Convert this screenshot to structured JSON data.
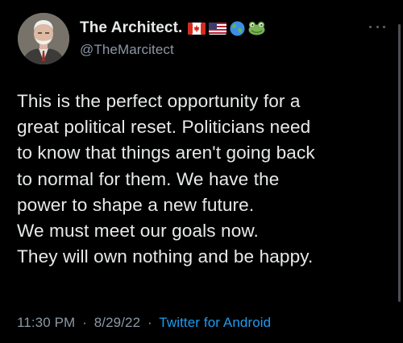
{
  "author": {
    "display_name": "The Architect.",
    "handle": "@TheMarcitect",
    "badges": [
      "canada-flag-icon",
      "us-flag-icon",
      "globe-icon",
      "frog-icon"
    ]
  },
  "tweet": {
    "lines": [
      "This is the perfect opportunity for a",
      "great political reset. Politicians need",
      "to know that things aren't going back",
      "to normal for them. We have the",
      "power to shape a new future.",
      "We must meet our goals now.",
      "They will own nothing and be happy."
    ]
  },
  "meta": {
    "time": "11:30 PM",
    "separator": "·",
    "date": "8/29/22",
    "source": "Twitter for Android"
  },
  "colors": {
    "background": "#000000",
    "text": "#e7e9ea",
    "secondary": "#8b98a5",
    "link": "#1d9bf0"
  }
}
